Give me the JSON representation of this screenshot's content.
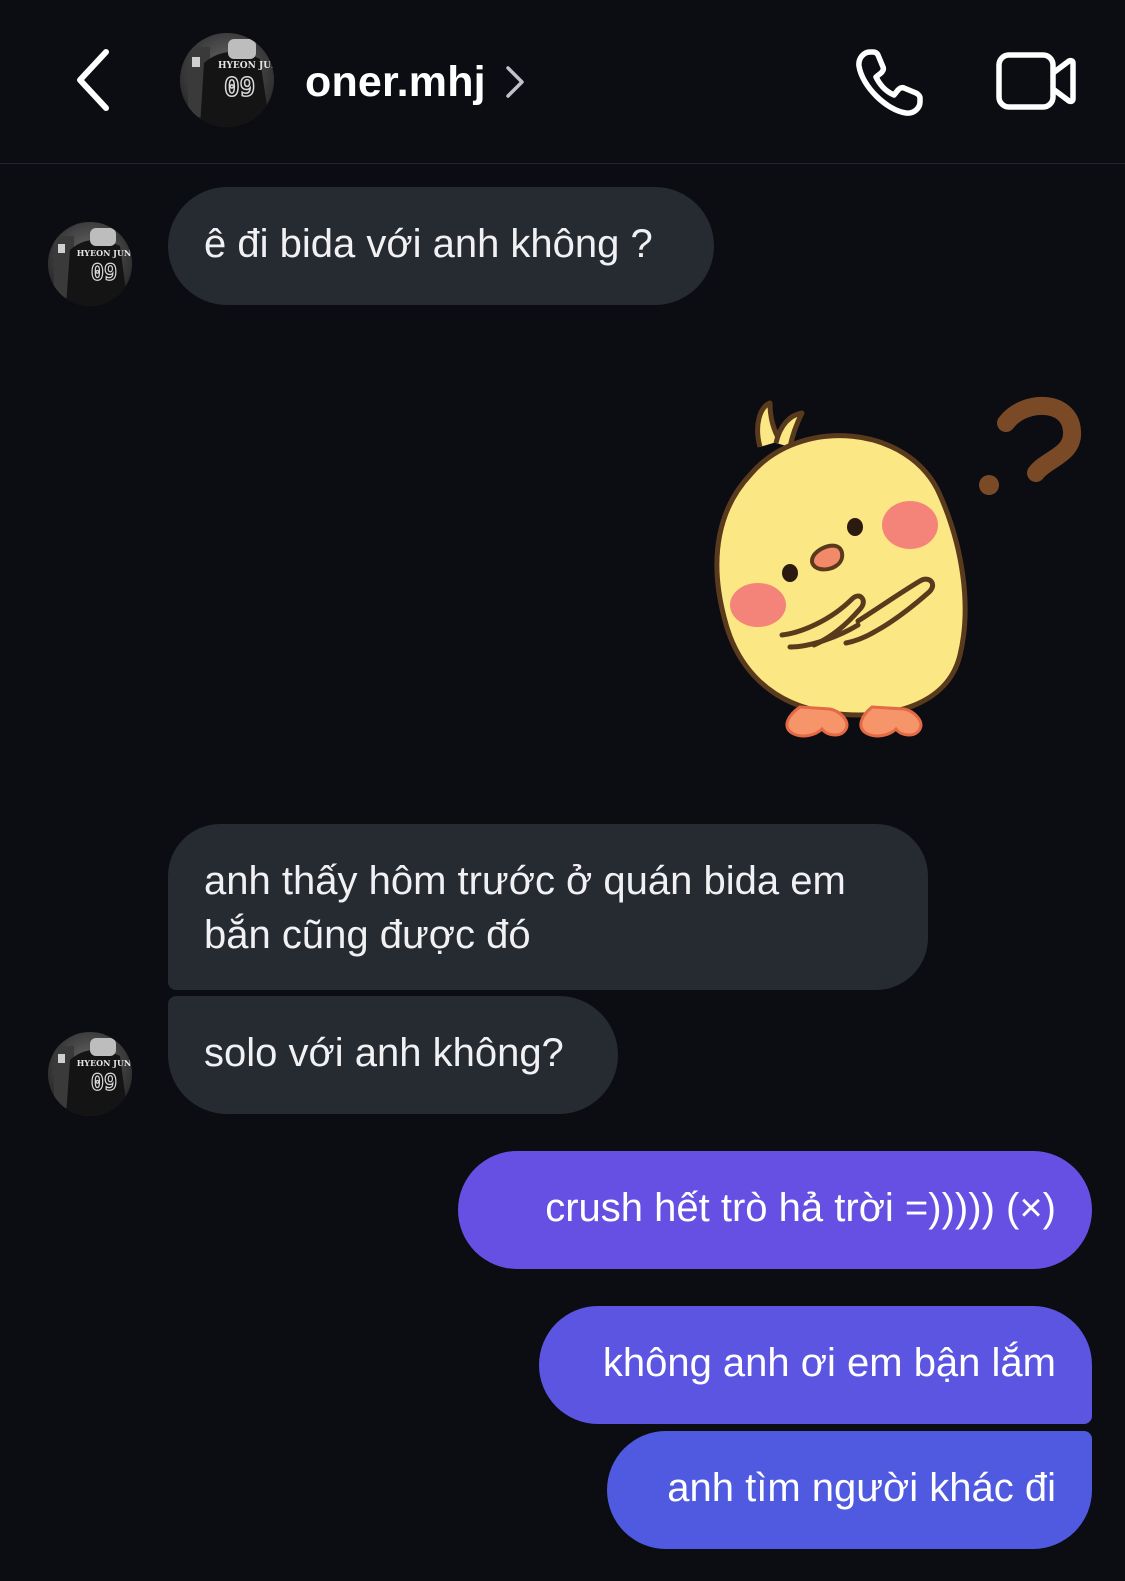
{
  "header": {
    "username": "oner.mhj",
    "avatar_text_top": "HYEON JUN",
    "avatar_text_number": "09"
  },
  "messages": [
    {
      "direction": "incoming",
      "text": "ê đi bida với anh không ?",
      "show_avatar": true
    },
    {
      "direction": "incoming",
      "type": "sticker",
      "sticker": "confused chick with question mark"
    },
    {
      "direction": "incoming",
      "text": "anh thấy hôm trước ở quán bida em bắn cũng được đó",
      "show_avatar": false
    },
    {
      "direction": "incoming",
      "text": "solo với anh không?",
      "show_avatar": true
    },
    {
      "direction": "outgoing",
      "text": "crush hết trò hả trời =))))) (×)"
    },
    {
      "direction": "outgoing",
      "text": "không anh ơi em bận lắm"
    },
    {
      "direction": "outgoing",
      "text": "anh tìm người khác đi"
    }
  ],
  "colors": {
    "background": "#0b0d12",
    "incoming_bubble": "#262a31",
    "outgoing_top": "#6c4ee6",
    "outgoing_bottom": "#4f5fe0"
  }
}
